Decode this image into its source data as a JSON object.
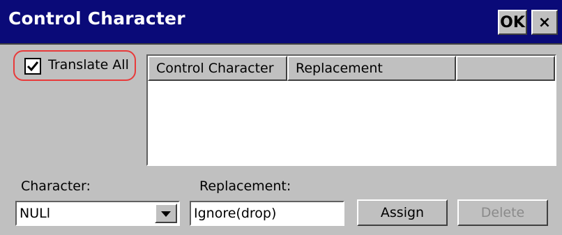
{
  "window": {
    "title": "Control Character",
    "ok_label": "OK",
    "close_label": "×"
  },
  "translate_all": {
    "label": "Translate All",
    "checked": true
  },
  "list": {
    "columns": [
      "Control Character",
      "Replacement",
      ""
    ],
    "rows": []
  },
  "character": {
    "label": "Character:",
    "value": "NULl"
  },
  "replacement": {
    "label": "Replacement:",
    "value": "Ignore(drop)"
  },
  "buttons": {
    "assign": "Assign",
    "delete": "Delete"
  },
  "colors": {
    "titlebar": "#0a0a78",
    "highlight": "#e83a3a",
    "face": "#c0c0c0",
    "disabled_text": "#8a8a8a"
  }
}
